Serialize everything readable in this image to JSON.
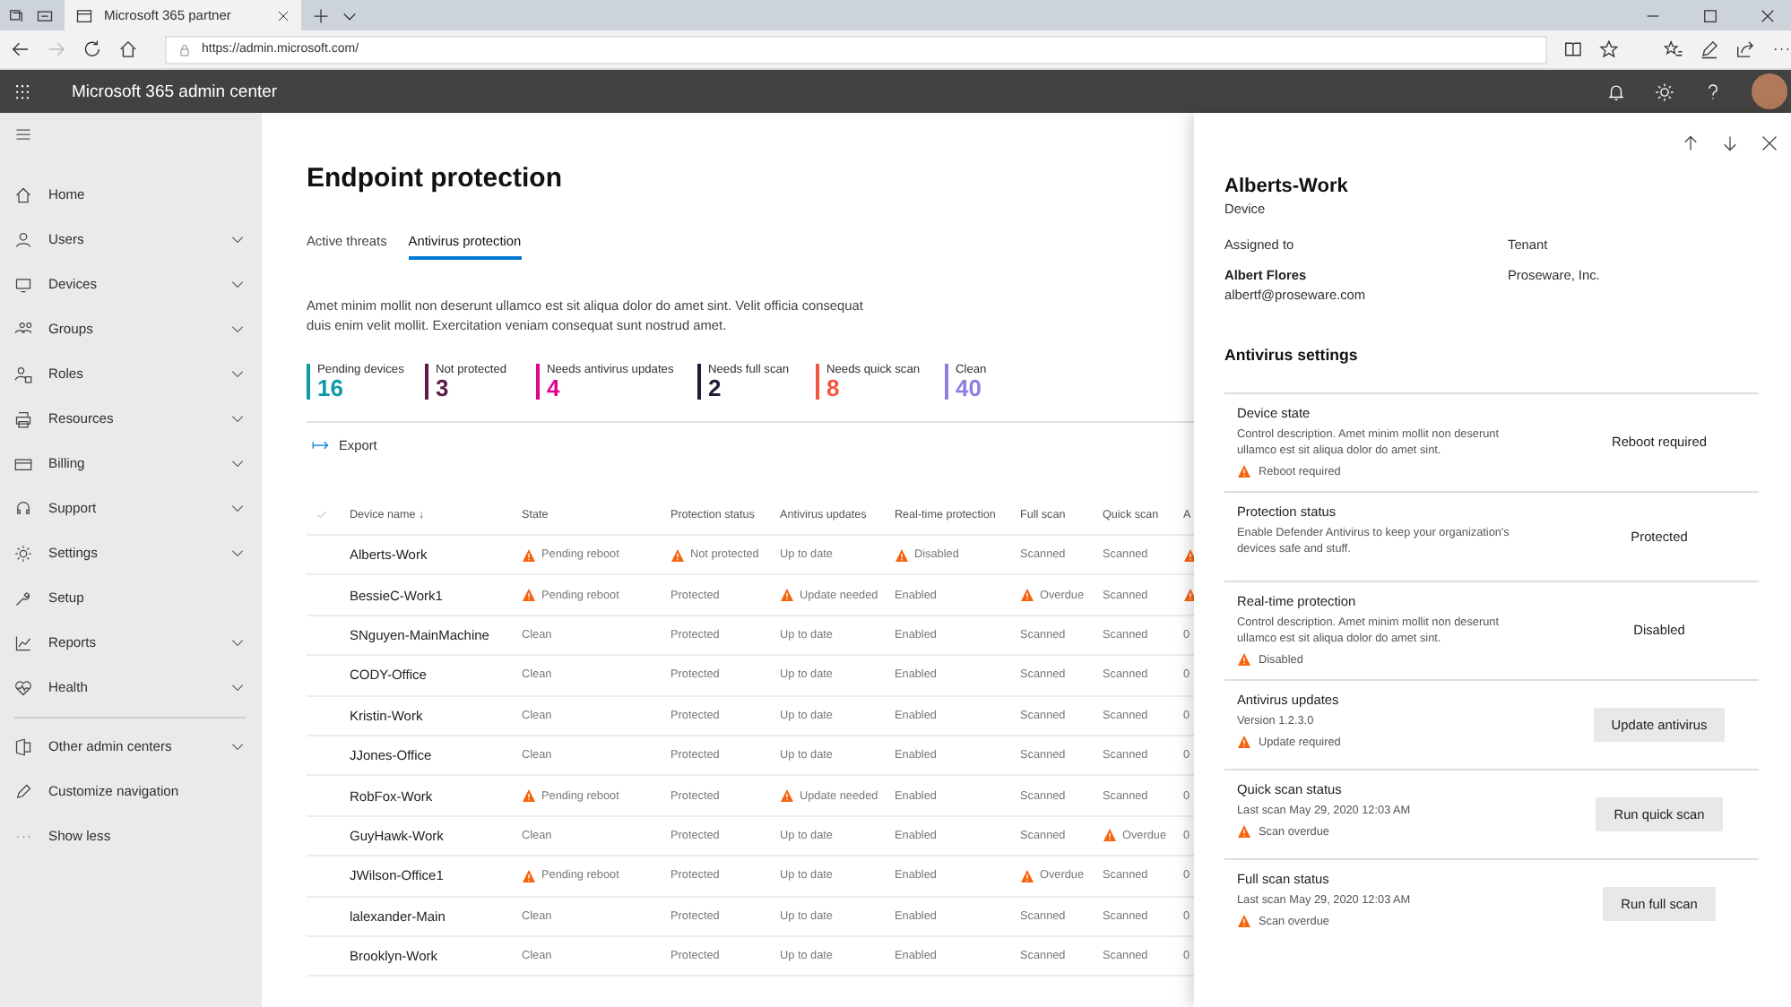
{
  "browser": {
    "tab_title": "Microsoft 365 partner",
    "url": "https://admin.microsoft.com/"
  },
  "header": {
    "app_title": "Microsoft 365 admin center"
  },
  "sidebar": {
    "items": [
      {
        "label": "Home",
        "expandable": false
      },
      {
        "label": "Users",
        "expandable": true
      },
      {
        "label": "Devices",
        "expandable": true
      },
      {
        "label": "Groups",
        "expandable": true
      },
      {
        "label": "Roles",
        "expandable": true
      },
      {
        "label": "Resources",
        "expandable": true
      },
      {
        "label": "Billing",
        "expandable": true
      },
      {
        "label": "Support",
        "expandable": true
      },
      {
        "label": "Settings",
        "expandable": true
      },
      {
        "label": "Setup",
        "expandable": false
      },
      {
        "label": "Reports",
        "expandable": true
      },
      {
        "label": "Health",
        "expandable": true
      }
    ],
    "bottom_items": [
      {
        "label": "Other admin centers",
        "expandable": true
      },
      {
        "label": "Customize navigation",
        "expandable": false
      },
      {
        "label": "Show less",
        "expandable": false
      }
    ]
  },
  "page": {
    "title": "Endpoint protection",
    "tabs": [
      {
        "label": "Active threats",
        "selected": false
      },
      {
        "label": "Antivirus protection",
        "selected": true
      }
    ],
    "description": "Amet minim mollit non deserunt ullamco est sit aliqua dolor do amet sint. Velit officia consequat duis enim velit mollit. Exercitation veniam consequat sunt nostrud amet.",
    "stats": [
      {
        "label": "Pending devices",
        "value": "16",
        "color": "#0e9aa7"
      },
      {
        "label": "Not protected",
        "value": "3",
        "color": "#5c1a4a"
      },
      {
        "label": "Needs antivirus updates",
        "value": "4",
        "color": "#e3008c"
      },
      {
        "label": "Needs full scan",
        "value": "2",
        "color": "#1b1f3b"
      },
      {
        "label": "Needs quick scan",
        "value": "8",
        "color": "#f4573f"
      },
      {
        "label": "Clean",
        "value": "40",
        "color": "#8f7ee0"
      }
    ],
    "export_label": "Export",
    "table": {
      "columns": [
        "Device name ↓",
        "State",
        "Protection status",
        "Antivirus updates",
        "Real-time protection",
        "Full scan",
        "Quick scan",
        "A"
      ],
      "rows": [
        {
          "cells": [
            {
              "text": "Alberts-Work"
            },
            {
              "text": "Pending reboot",
              "warn": true
            },
            {
              "text": "Not protected",
              "warn": true
            },
            {
              "text": "Up to date"
            },
            {
              "text": "Disabled",
              "warn": true
            },
            {
              "text": "Scanned"
            },
            {
              "text": "Scanned"
            },
            {
              "warn": true
            }
          ]
        },
        {
          "cells": [
            {
              "text": "BessieC-Work1"
            },
            {
              "text": "Pending reboot",
              "warn": true
            },
            {
              "text": "Protected"
            },
            {
              "text": "Update needed",
              "warn": true
            },
            {
              "text": "Enabled"
            },
            {
              "text": "Overdue",
              "warn": true
            },
            {
              "text": "Scanned"
            },
            {
              "warn": true
            }
          ]
        },
        {
          "cells": [
            {
              "text": "SNguyen-MainMachine"
            },
            {
              "text": "Clean"
            },
            {
              "text": "Protected"
            },
            {
              "text": "Up to date"
            },
            {
              "text": "Enabled"
            },
            {
              "text": "Scanned"
            },
            {
              "text": "Scanned"
            },
            {
              "text": "0"
            }
          ]
        },
        {
          "cells": [
            {
              "text": "CODY-Office"
            },
            {
              "text": "Clean"
            },
            {
              "text": "Protected"
            },
            {
              "text": "Up to date"
            },
            {
              "text": "Enabled"
            },
            {
              "text": "Scanned"
            },
            {
              "text": "Scanned"
            },
            {
              "text": "0"
            }
          ]
        },
        {
          "cells": [
            {
              "text": "Kristin-Work"
            },
            {
              "text": "Clean"
            },
            {
              "text": "Protected"
            },
            {
              "text": "Up to date"
            },
            {
              "text": "Enabled"
            },
            {
              "text": "Scanned"
            },
            {
              "text": "Scanned"
            },
            {
              "text": "0"
            }
          ]
        },
        {
          "cells": [
            {
              "text": "JJones-Office"
            },
            {
              "text": "Clean"
            },
            {
              "text": "Protected"
            },
            {
              "text": "Up to date"
            },
            {
              "text": "Enabled"
            },
            {
              "text": "Scanned"
            },
            {
              "text": "Scanned"
            },
            {
              "text": "0"
            }
          ]
        },
        {
          "cells": [
            {
              "text": "RobFox-Work"
            },
            {
              "text": "Pending reboot",
              "warn": true
            },
            {
              "text": "Protected"
            },
            {
              "text": "Update needed",
              "warn": true
            },
            {
              "text": "Enabled"
            },
            {
              "text": "Scanned"
            },
            {
              "text": "Scanned"
            },
            {
              "text": "0"
            }
          ]
        },
        {
          "cells": [
            {
              "text": "GuyHawk-Work"
            },
            {
              "text": "Clean"
            },
            {
              "text": "Protected"
            },
            {
              "text": "Up to date"
            },
            {
              "text": "Enabled"
            },
            {
              "text": "Scanned"
            },
            {
              "text": "Overdue",
              "warn": true
            },
            {
              "text": "0"
            }
          ]
        },
        {
          "cells": [
            {
              "text": "JWilson-Office1"
            },
            {
              "text": "Pending reboot",
              "warn": true
            },
            {
              "text": "Protected"
            },
            {
              "text": "Up to date"
            },
            {
              "text": "Enabled"
            },
            {
              "text": "Overdue",
              "warn": true
            },
            {
              "text": "Scanned"
            },
            {
              "text": "0"
            }
          ]
        },
        {
          "cells": [
            {
              "text": "lalexander-Main"
            },
            {
              "text": "Clean"
            },
            {
              "text": "Protected"
            },
            {
              "text": "Up to date"
            },
            {
              "text": "Enabled"
            },
            {
              "text": "Scanned"
            },
            {
              "text": "Scanned"
            },
            {
              "text": "0"
            }
          ]
        },
        {
          "cells": [
            {
              "text": "Brooklyn-Work"
            },
            {
              "text": "Clean"
            },
            {
              "text": "Protected"
            },
            {
              "text": "Up to date"
            },
            {
              "text": "Enabled"
            },
            {
              "text": "Scanned"
            },
            {
              "text": "Scanned"
            },
            {
              "text": "0"
            }
          ]
        }
      ]
    }
  },
  "panel": {
    "title": "Alberts-Work",
    "subtitle": "Device",
    "assigned_label": "Assigned to",
    "assigned_name": "Albert Flores",
    "assigned_email": "albertf@proseware.com",
    "tenant_label": "Tenant",
    "tenant_value": "Proseware, Inc.",
    "section_title": "Antivirus settings",
    "settings": [
      {
        "kind": "value",
        "title": "Device state",
        "description": "Control description. Amet minim mollit non deserunt ullamco est sit aliqua dolor do amet sint.",
        "warning": "Reboot required",
        "value": "Reboot required"
      },
      {
        "kind": "value",
        "title": "Protection status",
        "description": "Enable Defender Antivirus to keep your organization's devices safe and stuff.",
        "value": "Protected"
      },
      {
        "kind": "value",
        "title": "Real-time protection",
        "description": "Control description. Amet minim mollit non deserunt ullamco est sit aliqua dolor do amet sint.",
        "warning": "Disabled",
        "value": "Disabled"
      },
      {
        "kind": "button",
        "title": "Antivirus updates",
        "description": "Version 1.2.3.0",
        "warning": "Update required",
        "button": "Update antivirus"
      },
      {
        "kind": "button",
        "title": "Quick scan status",
        "description": "Last scan May 29, 2020 12:03 AM",
        "warning": "Scan overdue",
        "button": "Run quick scan"
      },
      {
        "kind": "button",
        "title": "Full scan status",
        "description": "Last scan May 29, 2020 12:03 AM",
        "warning": "Scan overdue",
        "button": "Run full scan"
      }
    ]
  }
}
